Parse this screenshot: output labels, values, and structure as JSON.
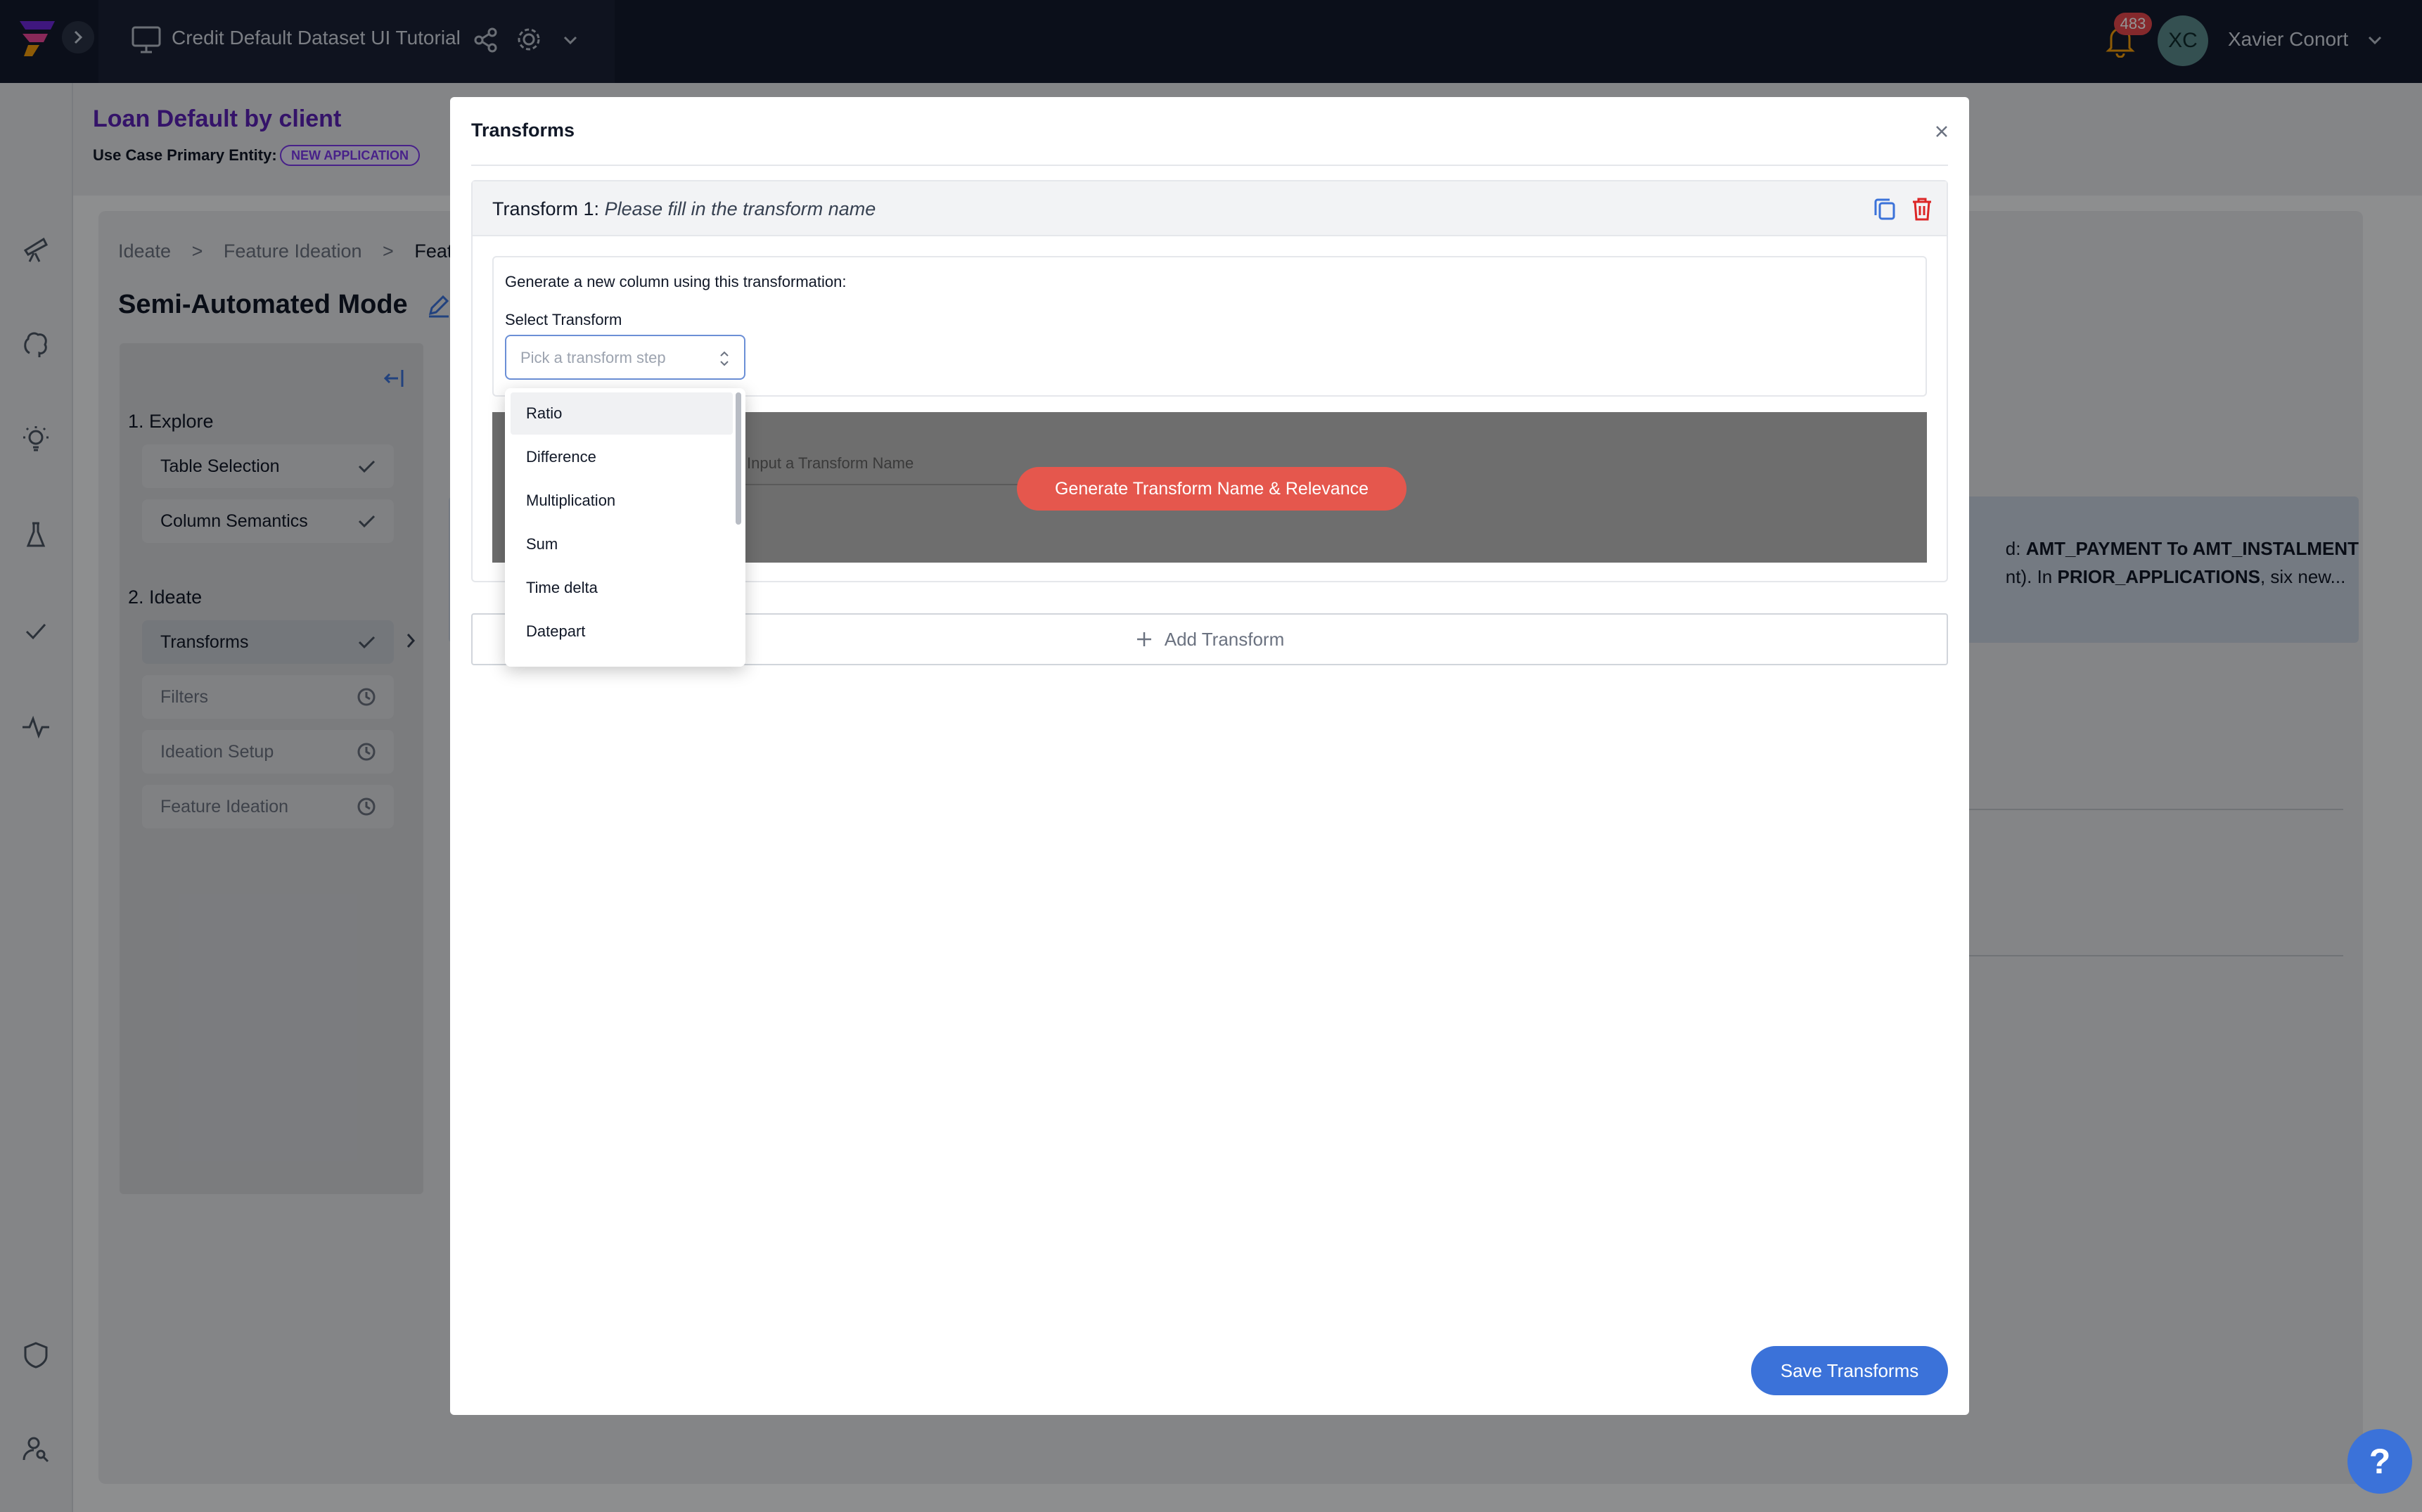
{
  "topbar": {
    "project_title": "Credit Default Dataset UI Tutorial",
    "notifications_count": "483",
    "user_initials": "XC",
    "user_name": "Xavier Conort",
    "icons": [
      "logo-icon",
      "expand-icon",
      "monitor-icon",
      "share-icon",
      "gear-icon",
      "chevron-down-icon",
      "bell-icon"
    ]
  },
  "rail": {
    "icons": [
      "telescope-icon",
      "brain-icon",
      "lightbulb-icon",
      "flask-icon",
      "check-icon",
      "activity-icon",
      "shield-icon",
      "user-search-icon"
    ]
  },
  "page": {
    "title": "Loan Default by client",
    "entity_label": "Use Case Primary Entity:",
    "entity_badge": "NEW APPLICATION",
    "breadcrumbs": [
      "Ideate",
      ">",
      "Feature Ideation",
      ">",
      "Feature"
    ],
    "mode_title": "Semi-Automated Mode",
    "sections": [
      {
        "heading": "1. Explore",
        "steps": [
          {
            "label": "Table Selection",
            "status": "done"
          },
          {
            "label": "Column Semantics",
            "status": "done"
          }
        ]
      },
      {
        "heading": "2. Ideate",
        "steps": [
          {
            "label": "Transforms",
            "status": "done"
          },
          {
            "label": "Filters",
            "status": "pending"
          },
          {
            "label": "Ideation Setup",
            "status": "pending"
          },
          {
            "label": "Feature Ideation",
            "status": "pending"
          }
        ]
      }
    ],
    "info_line1_prefix": "d: ",
    "info_line1_bold": "AMT_PAYMENT To AMT_INSTALMENT",
    "info_line2_prefix": "nt). In ",
    "info_line2_bold": "PRIOR_APPLICATIONS",
    "info_line2_suffix": ", six new..."
  },
  "modal": {
    "title": "Transforms",
    "transform_label": "Transform 1:",
    "transform_name_placeholder": "Please fill in the transform name",
    "generate_prompt": "Generate a new column using this transformation:",
    "select_label": "Select Transform",
    "select_placeholder": "Pick a transform step",
    "name_input_placeholder": "Input a Transform Name",
    "generate_button": "Generate Transform Name & Relevance",
    "add_transform": "Add Transform",
    "save_button": "Save Transforms",
    "options": [
      "Ratio",
      "Difference",
      "Multiplication",
      "Sum",
      "Time delta",
      "Datepart"
    ],
    "highlighted_option": "Ratio"
  },
  "help_label": "?",
  "colors": {
    "topbar": "#141b2d",
    "accent_blue": "#3b72d9",
    "generate_red": "#e5574d",
    "title_purple": "#5b21b6",
    "badge": "#e5484d"
  }
}
